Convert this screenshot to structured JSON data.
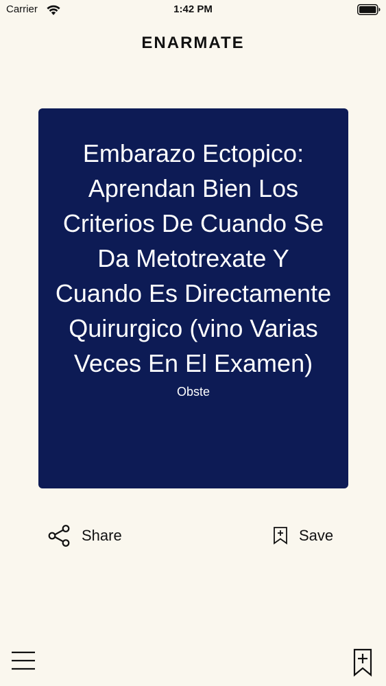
{
  "status_bar": {
    "carrier": "Carrier",
    "time": "1:42 PM",
    "icons": [
      "wifi-icon",
      "battery-icon"
    ]
  },
  "header": {
    "title": "ENARMATE"
  },
  "card": {
    "title": "Embarazo Ectopico: Aprendan Bien Los Criterios De Cuando Se Da Metotrexate Y Cuando Es Directamente Quirurgico (vino Varias Veces En El Examen)",
    "category": "Obste",
    "background_color": "#0d1b55"
  },
  "actions": {
    "share_label": "Share",
    "save_label": "Save",
    "icons": [
      "share-icon",
      "bookmark-add-icon"
    ]
  },
  "bottom_bar": {
    "icons": [
      "hamburger-menu-icon",
      "bookmarks-icon"
    ]
  }
}
